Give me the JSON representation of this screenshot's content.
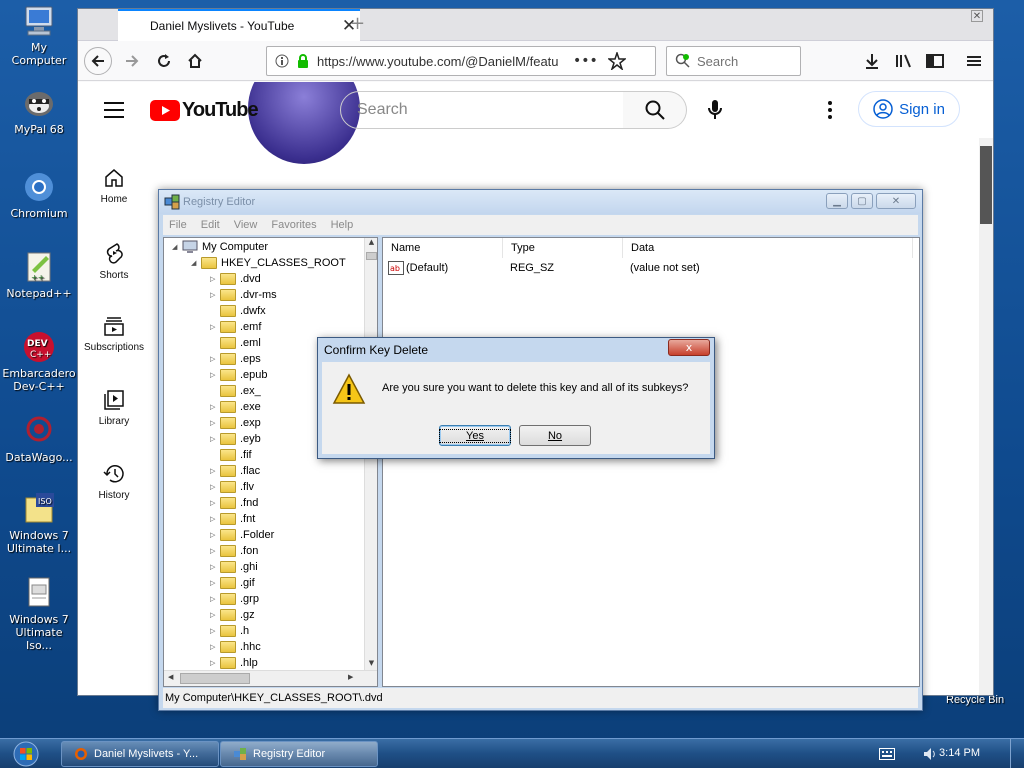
{
  "desktop": {
    "icons": [
      {
        "label": "My Computer",
        "icon": "computer-icon"
      },
      {
        "label": "MyPal 68",
        "icon": "mypal-icon"
      },
      {
        "label": "Chromium",
        "icon": "chromium-icon"
      },
      {
        "label": "Notepad++",
        "icon": "notepad-icon"
      },
      {
        "label": "Embarcadero\nDev-C++",
        "icon": "devcpp-icon"
      },
      {
        "label": "DataWago...",
        "icon": "datawagon-icon"
      },
      {
        "label": "Windows 7\nUltimate I...",
        "icon": "iso-icon"
      },
      {
        "label": "Windows 7\nUltimate Iso...",
        "icon": "document-icon"
      }
    ],
    "recycle_bin_label": "Recycle Bin"
  },
  "browser": {
    "tab_title": "Daniel Myslivets - YouTube",
    "url": "https://www.youtube.com/@DanielM/featu",
    "search_placeholder": "Search"
  },
  "youtube": {
    "logo_text": "YouTube",
    "search_placeholder": "Search",
    "signin_label": "Sign in",
    "sidebar": [
      {
        "label": "Home",
        "icon": "home-icon"
      },
      {
        "label": "Shorts",
        "icon": "shorts-icon"
      },
      {
        "label": "Subscriptions",
        "icon": "subscriptions-icon"
      },
      {
        "label": "Library",
        "icon": "library-icon"
      },
      {
        "label": "History",
        "icon": "history-icon"
      }
    ]
  },
  "regedit": {
    "title": "Registry Editor",
    "menu": [
      "File",
      "Edit",
      "View",
      "Favorites",
      "Help"
    ],
    "tree_root": "My Computer",
    "tree_hive": "HKEY_CLASSES_ROOT",
    "tree_keys": [
      ".dvd",
      ".dvr-ms",
      ".dwfx",
      ".emf",
      ".eml",
      ".eps",
      ".epub",
      ".ex_",
      ".exe",
      ".exp",
      ".eyb",
      ".fif",
      ".flac",
      ".flv",
      ".fnd",
      ".fnt",
      ".Folder",
      ".fon",
      ".ghi",
      ".gif",
      ".grp",
      ".gz",
      ".h",
      ".hhc",
      ".hlp"
    ],
    "columns": [
      "Name",
      "Type",
      "Data"
    ],
    "values": [
      {
        "name": "(Default)",
        "type": "REG_SZ",
        "data": "(value not set)"
      }
    ],
    "status_path": "My Computer\\HKEY_CLASSES_ROOT\\.dvd"
  },
  "dialog": {
    "title": "Confirm Key Delete",
    "message": "Are you sure you want to delete this key and all of its subkeys?",
    "yes_label": "Yes",
    "no_label": "No",
    "close_label": "x"
  },
  "taskbar": {
    "tasks": [
      {
        "label": "Daniel Myslivets - Y...",
        "active": false
      },
      {
        "label": "Registry Editor",
        "active": true
      }
    ],
    "clock": "3:14 PM"
  }
}
